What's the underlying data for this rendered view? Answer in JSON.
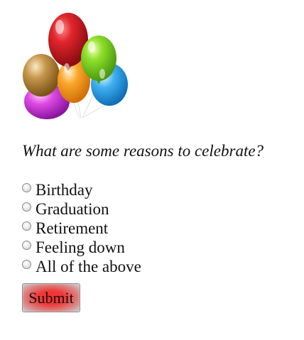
{
  "illustration": {
    "icon": "balloons-icon",
    "colors": [
      "#c8161d",
      "#7fd321",
      "#2b9de3",
      "#f7a21b",
      "#b5832f",
      "#d238d8"
    ]
  },
  "quiz": {
    "question": "What are some reasons to celebrate?",
    "options": [
      {
        "label": "Birthday"
      },
      {
        "label": "Graduation"
      },
      {
        "label": "Retirement"
      },
      {
        "label": "Feeling down"
      },
      {
        "label": "All of the above"
      }
    ],
    "submit_label": "Submit",
    "submit_color": "#ff2b2b"
  }
}
